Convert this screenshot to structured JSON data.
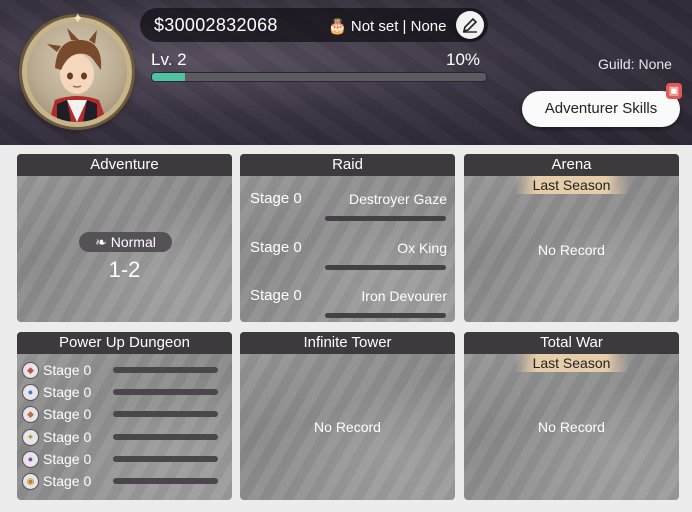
{
  "header": {
    "gold": "$30002832068",
    "birthday": "Not set | None",
    "birthday_icon": "cake-icon",
    "edit_icon": "pencil-icon",
    "level": "Lv. 2",
    "exp_percent_label": "10%",
    "exp_fraction": 0.1,
    "guild": "Guild: None",
    "adventurer_skills": "Adventurer Skills",
    "gift_icon": "gift-icon",
    "accent": "#4fc3a1"
  },
  "adventure": {
    "title": "Adventure",
    "mode": "Normal",
    "stage": "1-2"
  },
  "raid": {
    "title": "Raid",
    "rows": [
      {
        "stage": "Stage 0",
        "boss": "Destroyer Gaze"
      },
      {
        "stage": "Stage 0",
        "boss": "Ox King"
      },
      {
        "stage": "Stage 0",
        "boss": "Iron Devourer"
      }
    ]
  },
  "arena": {
    "title": "Arena",
    "season": "Last Season",
    "record": "No Record"
  },
  "power_up": {
    "title": "Power Up Dungeon",
    "rows": [
      {
        "stage": "Stage 0",
        "icon": "fire-element-icon"
      },
      {
        "stage": "Stage 0",
        "icon": "water-element-icon"
      },
      {
        "stage": "Stage 0",
        "icon": "earth-element-icon"
      },
      {
        "stage": "Stage 0",
        "icon": "light-element-icon"
      },
      {
        "stage": "Stage 0",
        "icon": "dark-element-icon"
      },
      {
        "stage": "Stage 0",
        "icon": "gold-element-icon"
      }
    ]
  },
  "infinite_tower": {
    "title": "Infinite Tower",
    "record": "No Record"
  },
  "total_war": {
    "title": "Total War",
    "season": "Last Season",
    "record": "No Record"
  }
}
